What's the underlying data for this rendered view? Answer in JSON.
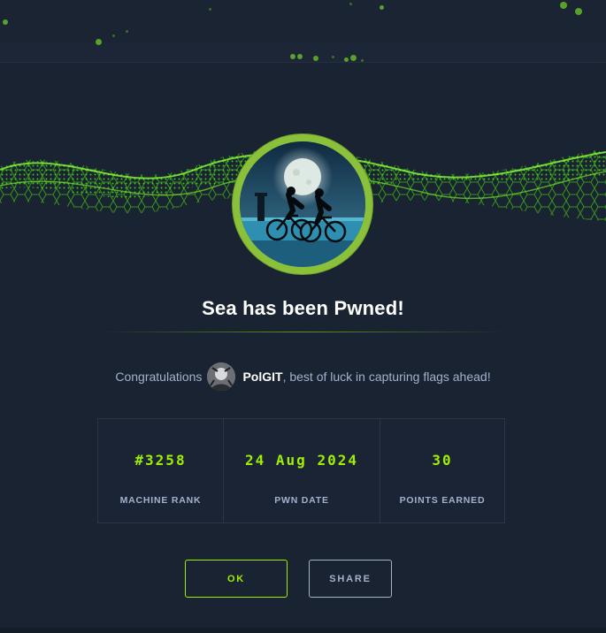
{
  "modal": {
    "title": "Sea has been Pwned!",
    "congrats_prefix": "Congratulations",
    "username": "PolGIT",
    "congrats_suffix": ", best of luck in capturing flags ahead!"
  },
  "stats": [
    {
      "value": "#3258",
      "label": "MACHINE RANK"
    },
    {
      "value": "24 Aug 2024",
      "label": "PWN DATE"
    },
    {
      "value": "30",
      "label": "POINTS EARNED"
    }
  ],
  "buttons": {
    "ok_label": "OK",
    "share_label": "SHARE"
  },
  "colors": {
    "background": "#1a2332",
    "accent": "#9fef00",
    "ring": "#8bc13a",
    "muted_text": "#a4b1cd"
  },
  "icons": {
    "machine_avatar": "cyclists-under-moon-image",
    "user_avatar": "user-avatar-image"
  }
}
